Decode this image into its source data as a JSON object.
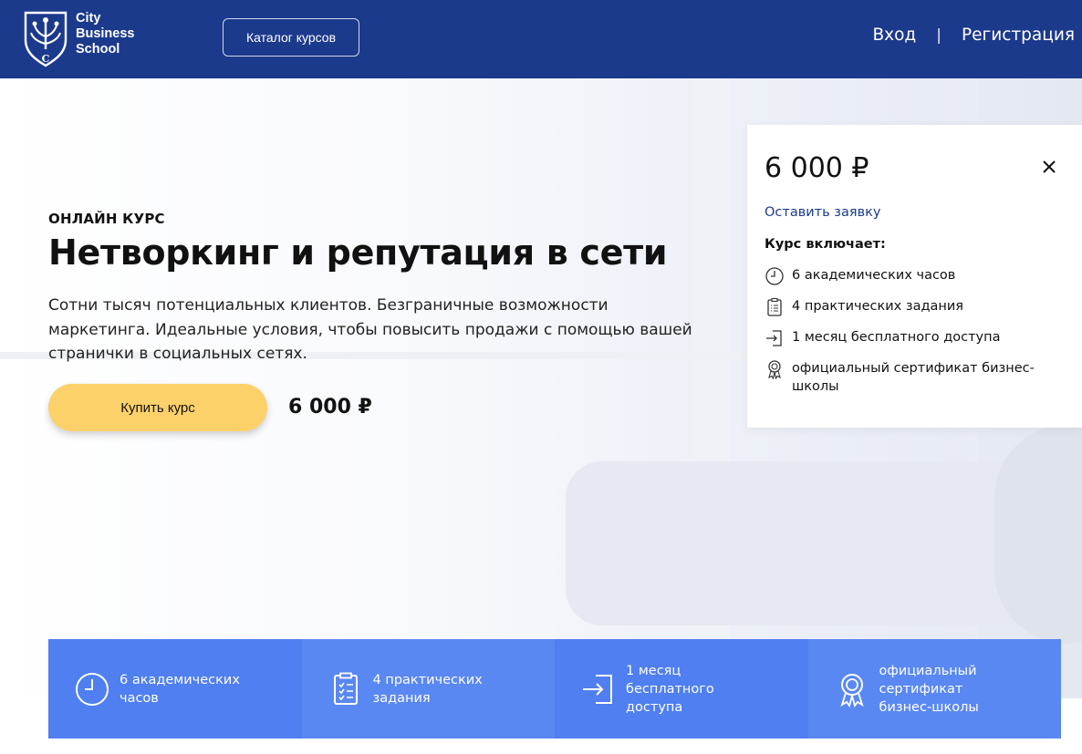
{
  "header": {
    "logo_text": [
      "City",
      "Business",
      "School"
    ],
    "catalog_label": "Каталог курсов",
    "login_label": "Вход",
    "separator": "|",
    "register_label": "Регистрация"
  },
  "hero": {
    "kicker": "ОНЛАЙН КУРС",
    "title": "Нетворкинг и репутация в сети",
    "description": "Сотни тысяч потенциальных клиентов. Безграничные возможности маркетинга. Идеальные условия, чтобы повысить продажи с помощью вашей странички в социальных сетях.",
    "buy_label": "Купить курс",
    "price": "6 000 ₽"
  },
  "card": {
    "price": "6 000 ₽",
    "link_label": "Оставить заявку",
    "heading": "Курс включает:",
    "items": [
      {
        "icon": "clock-icon",
        "label": "6 академических часов"
      },
      {
        "icon": "clipboard-icon",
        "label": "4 практических задания"
      },
      {
        "icon": "login-arrow-icon",
        "label": "1 месяц бесплатного доступа"
      },
      {
        "icon": "certificate-icon",
        "label": "официальный сертификат бизнес-школы"
      }
    ]
  },
  "features": [
    {
      "icon": "clock-icon",
      "label": "6 академических часов"
    },
    {
      "icon": "clipboard-icon",
      "label": "4 практических задания"
    },
    {
      "icon": "login-arrow-icon",
      "label": "1 месяц бесплатного доступа"
    },
    {
      "icon": "certificate-icon",
      "label": "официальный сертификат бизнес-школы"
    }
  ],
  "colors": {
    "header_bg": "#1c3a8c",
    "accent_yellow": "#fdd16a",
    "feature_blue": "#4f7ff0"
  }
}
